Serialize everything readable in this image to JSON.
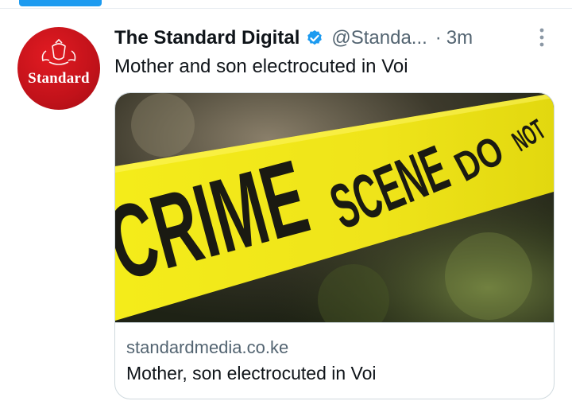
{
  "tweet": {
    "display_name": "The Standard Digital",
    "handle": "@Standa...",
    "separator": "·",
    "time": "3m",
    "text": "Mother and son electrocuted in Voi",
    "verified": true
  },
  "avatar": {
    "logo_text": "Standard",
    "color": "#c2121a"
  },
  "card": {
    "image_text": "CRIME SCENE DO NOT",
    "image_description_icon": "crime-scene-tape-photo",
    "domain": "standardmedia.co.ke",
    "title": "Mother, son electrocuted in Voi"
  },
  "colors": {
    "accent": "#1d9bf0",
    "secondary_text": "#536471",
    "tape_yellow": "#f2e900"
  }
}
